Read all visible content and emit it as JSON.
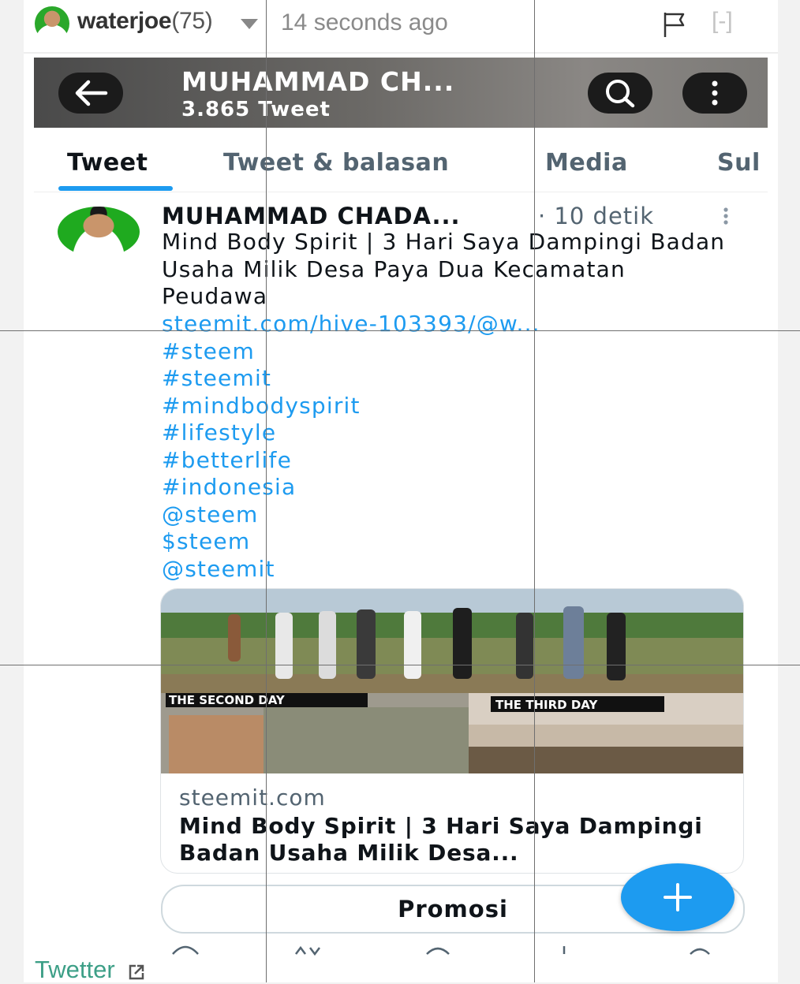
{
  "comment": {
    "author": "waterjoe",
    "reputation": "(75)",
    "timestamp": "14 seconds ago",
    "collapse_label": "[-]"
  },
  "twitter_profile": {
    "name": "MUHAMMAD CH...",
    "tweet_count": "3.865 Tweet",
    "tabs": [
      {
        "label": "Tweet",
        "active": true
      },
      {
        "label": "Tweet & balasan",
        "active": false
      },
      {
        "label": "Media",
        "active": false
      },
      {
        "label": "Sul",
        "active": false
      }
    ]
  },
  "tweet": {
    "author": "MUHAMMAD CHADA...",
    "time": "· 10 detik",
    "text": "Mind Body Spirit | 3 Hari Saya Dampingi Badan Usaha Milik Desa Paya Dua Kecamatan Peudawa",
    "links": [
      "steemit.com/hive-103393/@w...",
      "#steem",
      "#steemit",
      "#mindbodyspirit",
      "#lifestyle",
      "#betterlife",
      "#indonesia",
      "@steem",
      "$steem",
      "@steemit"
    ],
    "card": {
      "photo_label_left": "THE SECOND DAY",
      "photo_label_right": "THE THIRD DAY",
      "domain": "steemit.com",
      "title": "Mind Body Spirit | 3 Hari Saya Dampingi Badan Usaha Milik Desa..."
    },
    "promo_label": "Promosi"
  },
  "footer": {
    "source_link": "Twetter"
  },
  "colors": {
    "twitter_blue": "#1d9bf0",
    "steemit_green": "#3d9f87"
  },
  "icons": [
    "flag-icon",
    "back-arrow-icon",
    "search-icon",
    "more-vertical-icon",
    "plus-icon",
    "external-link-icon"
  ]
}
